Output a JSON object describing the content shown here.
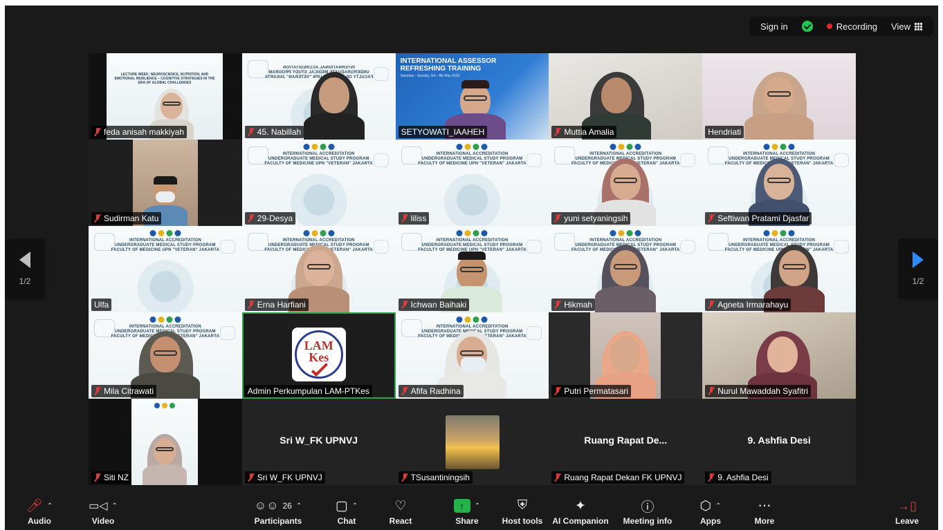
{
  "topbar": {
    "sign_in": "Sign in",
    "recording": "Recording",
    "view": "View"
  },
  "pager": {
    "left": "1/2",
    "right": "1/2"
  },
  "slide_texts": {
    "accreditation": "INTERNATIONAL ACCREDITATION\nUNDERGRADUATE MEDICAL STUDY PROGRAM\nFACULTY OF MEDICINE UPN \"VETERAN\" JAKARTA",
    "assessor_title": "INTERNATIONAL ASSESSOR\nREFRESHING TRAINING",
    "assessor_sub": "Saturday - Sunday, 3rd - 4th May 2025",
    "lecture": "LECTURE WEEK: NEUROSCIENCE, NUTRITION, AND EMOTIONAL RESILIENCE – COGNITIVE STRATEGIES IN THE ERA OF GLOBAL CHALLENGES",
    "lam_logo_top": "LAM",
    "lam_logo_bottom": "Kes"
  },
  "participants": [
    {
      "name": "feda anisah makkiyah",
      "muted": true
    },
    {
      "name": "45. Nabillah",
      "muted": true
    },
    {
      "name": "SETYOWATI_IAAHEH",
      "muted": false
    },
    {
      "name": "Muttia Amalia",
      "muted": true
    },
    {
      "name": "Hendriati",
      "muted": false
    },
    {
      "name": "Sudirman Katu",
      "muted": true
    },
    {
      "name": "29-Desya",
      "muted": true
    },
    {
      "name": "liliss",
      "muted": true
    },
    {
      "name": "yuni setyaningsih",
      "muted": true
    },
    {
      "name": "Seftiwan Pratami Djasfar",
      "muted": true
    },
    {
      "name": "Ulfa",
      "muted": false
    },
    {
      "name": "Erna Harfiani",
      "muted": true
    },
    {
      "name": "Ichwan Baihaki",
      "muted": true
    },
    {
      "name": "Hikmah",
      "muted": true
    },
    {
      "name": "Agneta Irmarahayu",
      "muted": true
    },
    {
      "name": "Mila Citrawati",
      "muted": true
    },
    {
      "name": "Admin Perkumpulan LAM-PTKes",
      "muted": false
    },
    {
      "name": "Afifa Radhina",
      "muted": true
    },
    {
      "name": "Putri Permatasari",
      "muted": true
    },
    {
      "name": "Nurul Mawaddah Syafitri",
      "muted": true
    },
    {
      "name": "Siti NZ",
      "muted": true
    },
    {
      "name": "Sri W_FK UPNVJ",
      "muted": true,
      "big_name": "Sri W_FK UPNVJ"
    },
    {
      "name": "TSusantiningsih",
      "muted": true
    },
    {
      "name": "Ruang Rapat Dekan FK UPNVJ",
      "muted": true,
      "big_name": "Ruang Rapat De..."
    },
    {
      "name": "9. Ashfia Desi",
      "muted": true,
      "big_name": "9. Ashfia Desi"
    }
  ],
  "toolbar": {
    "audio": "Audio",
    "video": "Video",
    "participants": "Participants",
    "participants_count": "26",
    "chat": "Chat",
    "react": "React",
    "share": "Share",
    "host_tools": "Host tools",
    "ai_companion": "AI Companion",
    "meeting_info": "Meeting info",
    "apps": "Apps",
    "more": "More",
    "leave": "Leave"
  },
  "colors": {
    "accent_green": "#23b34a",
    "record_red": "#e02828",
    "nav_blue": "#2d8cff"
  }
}
